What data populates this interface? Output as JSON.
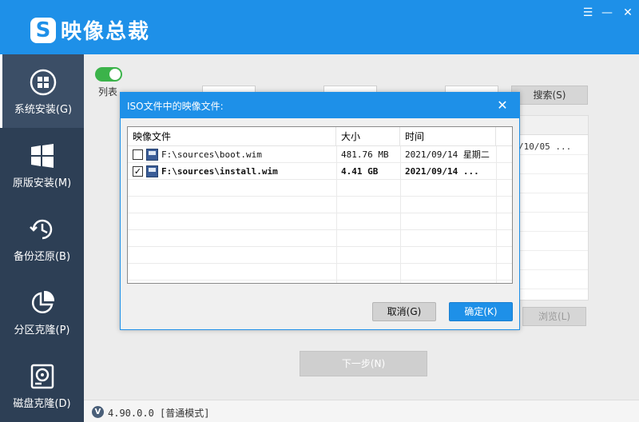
{
  "app": {
    "logo_mark": "S",
    "title": "映像总裁",
    "controls": {
      "menu": "☰",
      "minimize": "—",
      "close": "✕"
    }
  },
  "sidebar": {
    "items": [
      {
        "label": "系统安装(G)",
        "icon": "windows-logo-icon",
        "active": true
      },
      {
        "label": "原版安装(M)",
        "icon": "windows-tiles-icon",
        "active": false
      },
      {
        "label": "备份还原(B)",
        "icon": "clock-restore-icon",
        "active": false
      },
      {
        "label": "分区克隆(P)",
        "icon": "pie-chart-icon",
        "active": false
      },
      {
        "label": "磁盘克隆(D)",
        "icon": "disk-icon",
        "active": false
      }
    ]
  },
  "main": {
    "toggle_label": "列表",
    "search_button": "搜索(S)",
    "browse_button": "浏览(L)",
    "next_button": "下一步(N)",
    "bg_grid_text": "/10/05 ..."
  },
  "dialog": {
    "title": "ISO文件中的映像文件:",
    "close": "✕",
    "columns": [
      "映像文件",
      "大小",
      "时间"
    ],
    "rows": [
      {
        "checked": false,
        "file": "F:\\sources\\boot.wim",
        "size": "481.76 MB",
        "time": "2021/09/14 星期二"
      },
      {
        "checked": true,
        "file": "F:\\sources\\install.wim",
        "size": "4.41 GB",
        "time": "2021/09/14 ..."
      }
    ],
    "cancel_button": "取消(G)",
    "ok_button": "确定(K)"
  },
  "status": {
    "badge": "V",
    "version_text": "4.90.0.0 [普通模式]"
  },
  "colors": {
    "brand_blue": "#1e90e8",
    "sidebar_bg": "#2d3f55",
    "toggle_green": "#3bb34a"
  }
}
